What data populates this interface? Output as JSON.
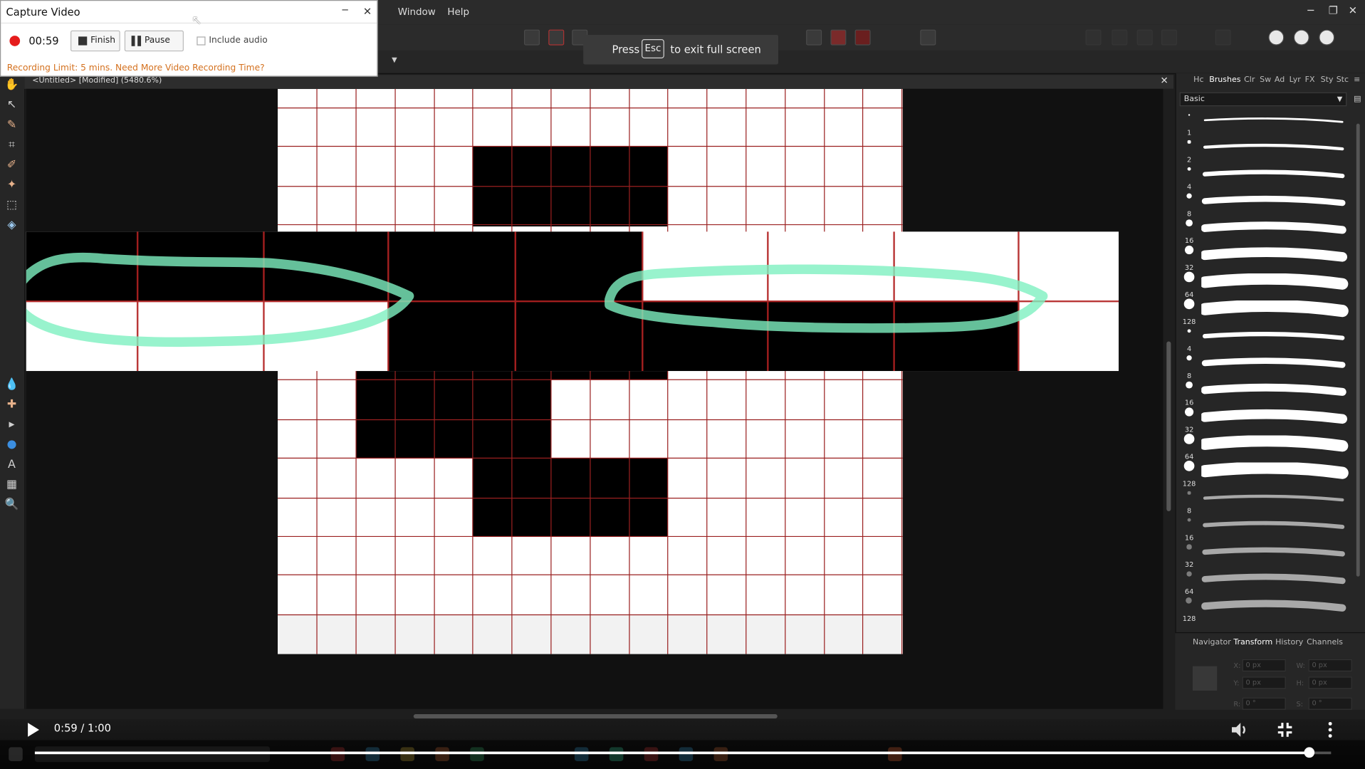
{
  "capture": {
    "title": "Capture Video",
    "timer": "00:59",
    "finish_label": "Finish",
    "pause_label": "Pause",
    "include_audio_label": "Include audio",
    "limit_text": "Recording Limit: 5 mins. Need More Video Recording Time?",
    "minimize": "─",
    "close": "✕"
  },
  "menubar": {
    "items": [
      "Window",
      "Help"
    ]
  },
  "fullscreen_notice": {
    "press": "Press",
    "key": "Esc",
    "rest": "to exit full screen"
  },
  "document": {
    "tab_title": "<Untitled> [Modified] (5480.6%)",
    "close": "✕"
  },
  "panel_tabs": [
    "Hc",
    "Brushes",
    "Clr",
    "Sw",
    "Ad",
    "Lyr",
    "FX",
    "Sty",
    "Stc"
  ],
  "brushes": {
    "category": "Basic",
    "sizes": [
      "1",
      "2",
      "4",
      "8",
      "16",
      "32",
      "64",
      "128",
      "4",
      "8",
      "16",
      "32",
      "64",
      "128",
      "8",
      "16",
      "32",
      "64",
      "128"
    ]
  },
  "transform_tabs": [
    "Navigator",
    "Transform",
    "History",
    "Channels"
  ],
  "transform": {
    "x_label": "X:",
    "y_label": "Y:",
    "w_label": "W:",
    "h_label": "H:",
    "r_label": "R:",
    "s_label": "S:",
    "x": "0 px",
    "y": "0 px",
    "w": "0 px",
    "h": "0 px",
    "r": "0 °",
    "s": "0 °"
  },
  "video": {
    "time": "0:59 / 1:00",
    "progress": 0.983
  },
  "colors": {
    "accent": "#e8b28b",
    "record": "#e51c1c",
    "limit_text": "#d4711f",
    "stroke": "#7ef0c0"
  }
}
